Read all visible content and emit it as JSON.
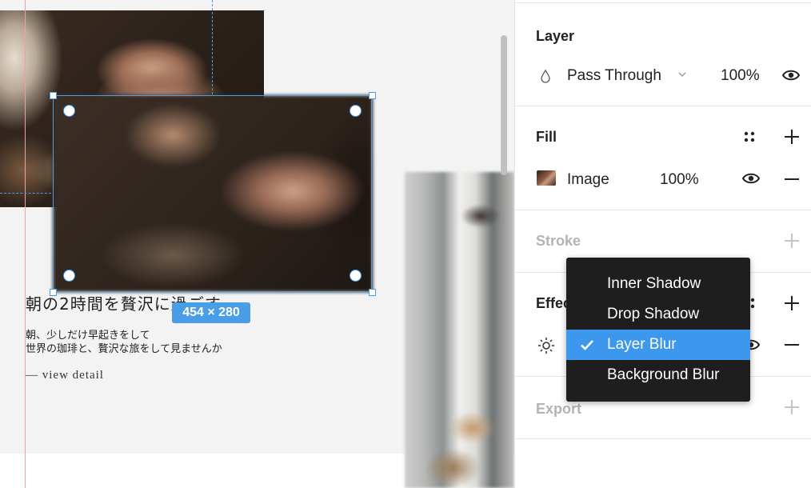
{
  "canvas": {
    "headline": "朝の2時間を贅沢に過ごす",
    "body_line1": "朝、少しだけ早起きをして",
    "body_line2": "世界の珈琲と、贅沢な旅をして見ませんか",
    "link": "— view detail",
    "selection_size": "454 × 280"
  },
  "panel": {
    "layer": {
      "title": "Layer",
      "blend_mode": "Pass Through",
      "opacity": "100%"
    },
    "fill": {
      "title": "Fill",
      "item_label": "Image",
      "item_opacity": "100%"
    },
    "stroke": {
      "title": "Stroke"
    },
    "effects": {
      "title": "Effects"
    },
    "export": {
      "title": "Export"
    }
  },
  "effect_menu": {
    "items": [
      {
        "label": "Inner Shadow",
        "selected": false
      },
      {
        "label": "Drop Shadow",
        "selected": false
      },
      {
        "label": "Layer Blur",
        "selected": true
      },
      {
        "label": "Background Blur",
        "selected": false
      }
    ]
  },
  "colors": {
    "accent": "#4a9ee8",
    "menu_selected": "#3d97ec",
    "menu_bg": "#1e1e1e",
    "muted_heading": "#b3b3b3"
  }
}
